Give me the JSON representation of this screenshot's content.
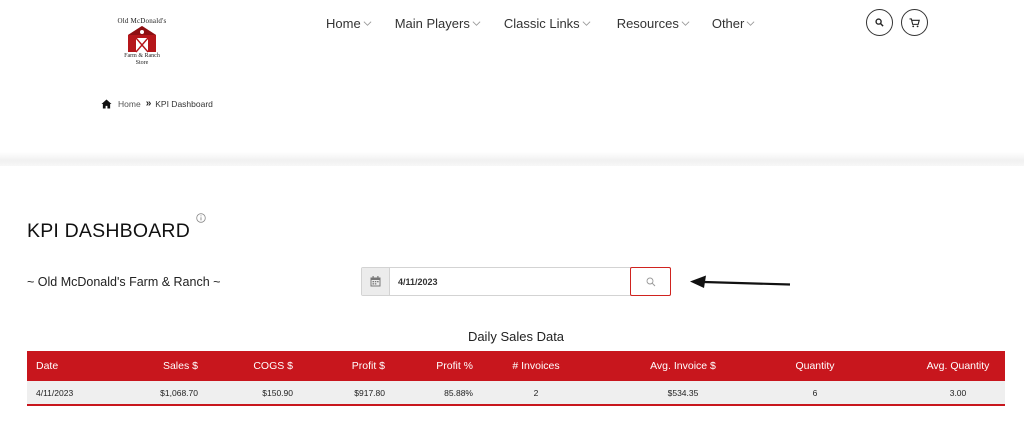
{
  "logo": {
    "top_text": "Old McDonald's",
    "bottom_text_line1": "Farm & Ranch",
    "bottom_text_line2": "Store"
  },
  "nav": {
    "items": [
      {
        "label": "Home"
      },
      {
        "label": "Main Players"
      },
      {
        "label": "Classic Links"
      },
      {
        "label": "Resources"
      },
      {
        "label": "Other"
      }
    ]
  },
  "header_icons": {
    "search": "search-icon",
    "cart": "cart-icon"
  },
  "breadcrumb": {
    "home": "Home",
    "separator": "»",
    "current": "KPI Dashboard"
  },
  "page": {
    "title": "KPI DASHBOARD",
    "store_name": "~ Old McDonald's Farm & Ranch ~"
  },
  "date_picker": {
    "value": "4/11/2023"
  },
  "table": {
    "caption": "Daily Sales Data",
    "headers": [
      "Date",
      "Sales $",
      "COGS $",
      "Profit $",
      "Profit %",
      "# Invoices",
      "Avg. Invoice $",
      "Quantity",
      "Avg. Quantity"
    ],
    "rows": [
      [
        "4/11/2023",
        "$1,068.70",
        "$150.90",
        "$917.80",
        "85.88%",
        "2",
        "$534.35",
        "6",
        "3.00"
      ]
    ]
  },
  "colors": {
    "accent": "#c8161d",
    "row_bg": "#efefef",
    "text": "#222222"
  }
}
